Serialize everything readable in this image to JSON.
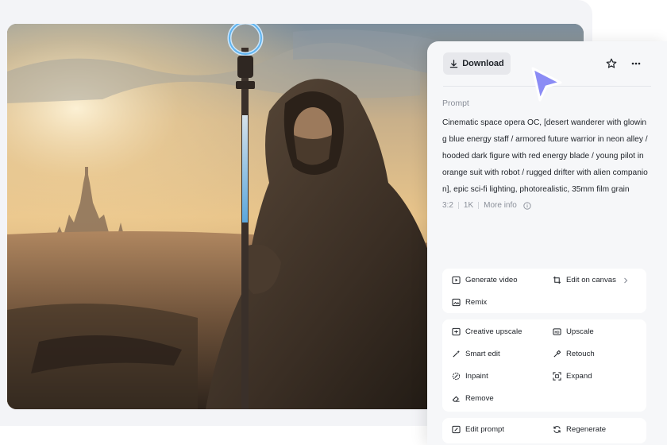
{
  "actions_top": {
    "download_label": "Download",
    "star_icon": "star-icon",
    "more_icon": "more-horizontal-icon"
  },
  "prompt": {
    "label": "Prompt",
    "text": "Cinematic space opera OC, [desert wanderer with glowing blue energy staff / armored future warrior in neon alley / hooded dark figure with red energy blade / young pilot in orange suit with robot / rugged drifter with alien companion], epic sci-fi lighting, photorealistic, 35mm film grain",
    "ratio": "3:2",
    "resolution": "1K",
    "more_info": "More info"
  },
  "tools": {
    "generate_video": "Generate video",
    "edit_on_canvas": "Edit on canvas",
    "remix": "Remix",
    "creative_upscale": "Creative upscale",
    "upscale": "Upscale",
    "smart_edit": "Smart edit",
    "retouch": "Retouch",
    "inpaint": "Inpaint",
    "expand": "Expand",
    "remove": "Remove",
    "edit_prompt": "Edit prompt",
    "regenerate": "Regenerate"
  },
  "colors": {
    "accent_cursor": "#8b8cf5",
    "panel_bg": "#f6f7f9",
    "text": "#1f2329",
    "muted": "#8a8f99",
    "staff_glow": "#9fd8ff"
  }
}
